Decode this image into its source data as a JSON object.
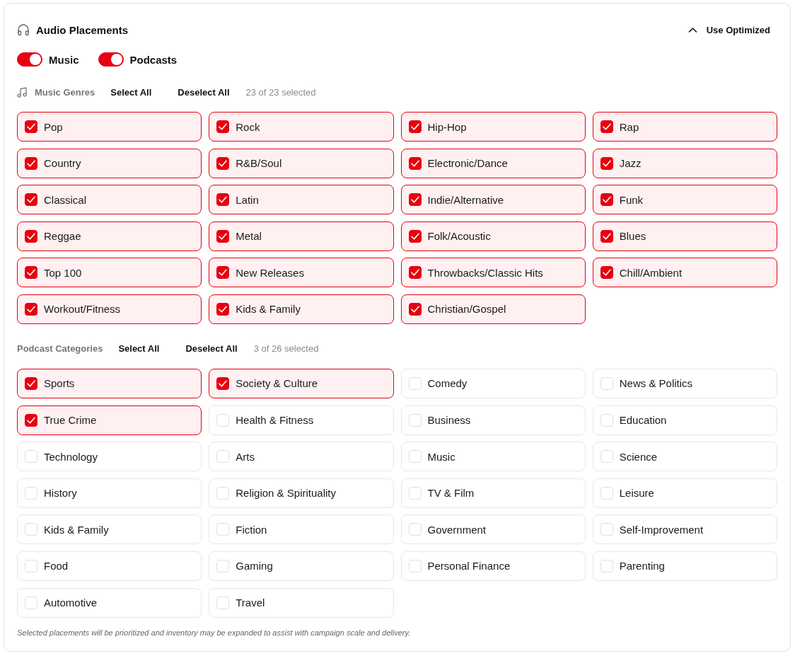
{
  "panel": {
    "title": "Audio Placements",
    "optimize_button": {
      "label": "Use Optimized",
      "expanded": true
    }
  },
  "toggles": [
    {
      "label": "Music",
      "on": true
    },
    {
      "label": "Podcasts",
      "on": true
    }
  ],
  "sections": [
    {
      "kind": "music",
      "title": "Music Genres",
      "select_all": "Select All",
      "deselect_all": "Deselect All",
      "count": "23 of 23 selected",
      "items": [
        {
          "label": "Pop",
          "checked": true
        },
        {
          "label": "Rock",
          "checked": true
        },
        {
          "label": "Hip-Hop",
          "checked": true
        },
        {
          "label": "Rap",
          "checked": true
        },
        {
          "label": "Country",
          "checked": true
        },
        {
          "label": "R&B/Soul",
          "checked": true
        },
        {
          "label": "Electronic/Dance",
          "checked": true
        },
        {
          "label": "Jazz",
          "checked": true
        },
        {
          "label": "Classical",
          "checked": true
        },
        {
          "label": "Latin",
          "checked": true
        },
        {
          "label": "Indie/Alternative",
          "checked": true
        },
        {
          "label": "Funk",
          "checked": true
        },
        {
          "label": "Reggae",
          "checked": true
        },
        {
          "label": "Metal",
          "checked": true
        },
        {
          "label": "Folk/Acoustic",
          "checked": true
        },
        {
          "label": "Blues",
          "checked": true
        },
        {
          "label": "Top 100",
          "checked": true
        },
        {
          "label": "New Releases",
          "checked": true
        },
        {
          "label": "Throwbacks/Classic Hits",
          "checked": true
        },
        {
          "label": "Chill/Ambient",
          "checked": true
        },
        {
          "label": "Workout/Fitness",
          "checked": true
        },
        {
          "label": "Kids & Family",
          "checked": true
        },
        {
          "label": "Christian/Gospel",
          "checked": true
        }
      ]
    },
    {
      "kind": "podcast",
      "title": "Podcast Categories",
      "select_all": "Select All",
      "deselect_all": "Deselect All",
      "count": "3 of 26 selected",
      "items": [
        {
          "label": "Sports",
          "checked": true
        },
        {
          "label": "Society & Culture",
          "checked": true
        },
        {
          "label": "Comedy",
          "checked": false
        },
        {
          "label": "News & Politics",
          "checked": false
        },
        {
          "label": "True Crime",
          "checked": true
        },
        {
          "label": "Health & Fitness",
          "checked": false
        },
        {
          "label": "Business",
          "checked": false
        },
        {
          "label": "Education",
          "checked": false
        },
        {
          "label": "Technology",
          "checked": false
        },
        {
          "label": "Arts",
          "checked": false
        },
        {
          "label": "Music",
          "checked": false
        },
        {
          "label": "Science",
          "checked": false
        },
        {
          "label": "History",
          "checked": false
        },
        {
          "label": "Religion & Spirituality",
          "checked": false
        },
        {
          "label": "TV & Film",
          "checked": false
        },
        {
          "label": "Leisure",
          "checked": false
        },
        {
          "label": "Kids & Family",
          "checked": false
        },
        {
          "label": "Fiction",
          "checked": false
        },
        {
          "label": "Government",
          "checked": false
        },
        {
          "label": "Self-Improvement",
          "checked": false
        },
        {
          "label": "Food",
          "checked": false
        },
        {
          "label": "Gaming",
          "checked": false
        },
        {
          "label": "Personal Finance",
          "checked": false
        },
        {
          "label": "Parenting",
          "checked": false
        },
        {
          "label": "Automotive",
          "checked": false
        },
        {
          "label": "Travel",
          "checked": false
        }
      ]
    }
  ],
  "footnote": "Selected placements will be prioritized and inventory may be expanded to assist with campaign scale and delivery."
}
